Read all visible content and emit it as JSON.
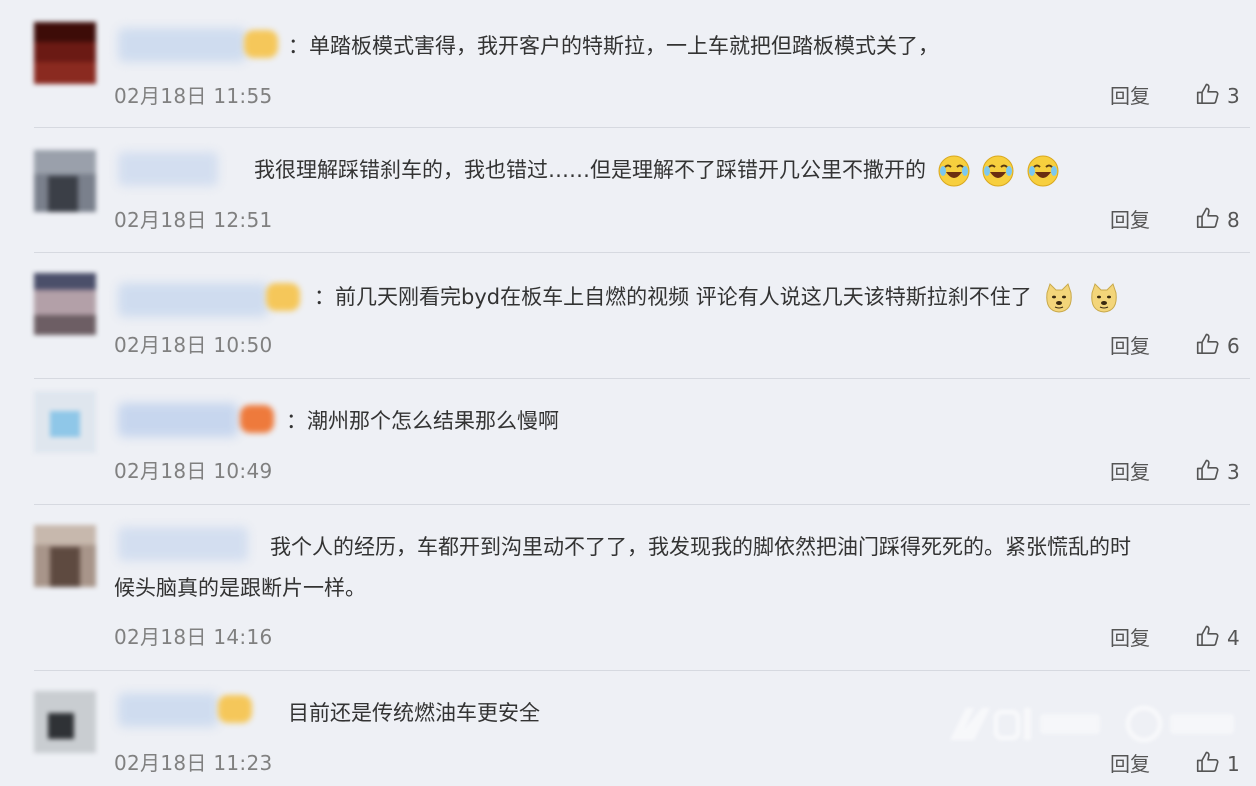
{
  "comments": [
    {
      "text": "：单踏板模式害得，我开客户的特斯拉，一上车就把但踏板模式关了，",
      "time": "02月18日 11:55",
      "reply": "回复",
      "likes": "3"
    },
    {
      "text": "我很理解踩错刹车的，我也错过……但是理解不了踩错开几公里不撒开的",
      "time": "02月18日 12:51",
      "reply": "回复",
      "likes": "8",
      "emojis": [
        "laugh-cry-emoji",
        "laugh-cry-emoji",
        "laugh-cry-emoji"
      ]
    },
    {
      "text": "：前几天刚看完byd在板车上自燃的视频 评论有人说这几天该特斯拉刹不住了",
      "time": "02月18日 10:50",
      "reply": "回复",
      "likes": "6",
      "emojis": [
        "doge-emoji",
        "doge-emoji"
      ]
    },
    {
      "text": "：潮州那个怎么结果那么慢啊",
      "time": "02月18日 10:49",
      "reply": "回复",
      "likes": "3"
    },
    {
      "text_line1": "我个人的经历，车都开到沟里动不了了，我发现我的脚依然把油门踩得死死的。紧张慌乱的时",
      "text_line2": "候头脑真的是跟断片一样。",
      "time": "02月18日 14:16",
      "reply": "回复",
      "likes": "4"
    },
    {
      "text": "目前还是传统燃油车更安全",
      "time": "02月18日 11:23",
      "reply": "回复",
      "likes": "1"
    }
  ],
  "icons": {
    "like": "thumbs-up-icon"
  },
  "colors": {
    "background": "#eef0f5",
    "divider": "#d6d9e0",
    "time": "#808080",
    "name_blur": "#c9d8ee",
    "badge_yellow": "#f5c75a",
    "badge_orange": "#ee7a3c"
  }
}
